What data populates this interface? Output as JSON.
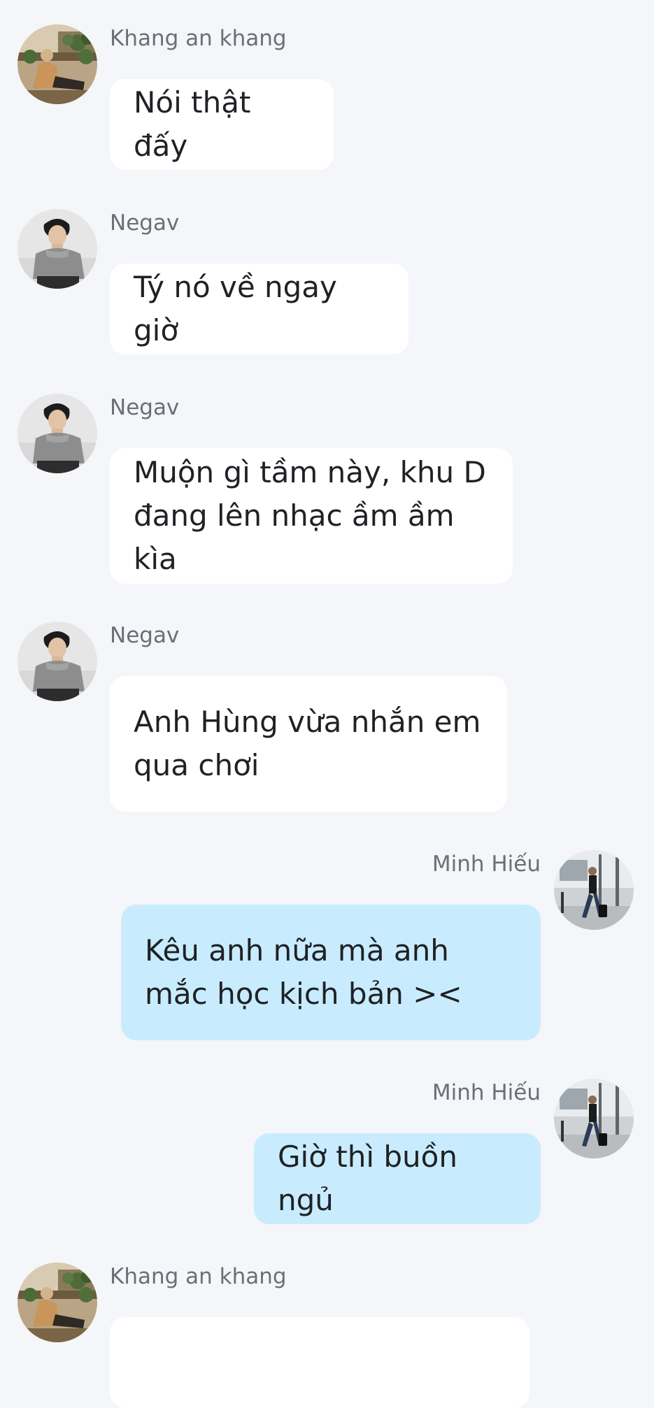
{
  "messages": [
    {
      "sender": "Khang an khang",
      "text": "Nói thật đấy",
      "direction": "incoming",
      "avatar": "avatar-khang-icon"
    },
    {
      "sender": "Negav",
      "text": "Tý nó về ngay giờ",
      "direction": "incoming",
      "avatar": "avatar-negav-icon"
    },
    {
      "sender": "Negav",
      "text": "Muộn gì tầm này, khu D đang lên nhạc ầm ầm kìa",
      "direction": "incoming",
      "avatar": "avatar-negav-icon"
    },
    {
      "sender": "Negav",
      "text": "Anh Hùng vừa nhắn em qua chơi",
      "direction": "incoming",
      "avatar": "avatar-negav-icon"
    },
    {
      "sender": "Minh Hiếu",
      "text": "Kêu anh nữa mà anh mắc học kịch bản ><",
      "direction": "outgoing",
      "avatar": "avatar-minhhieu-icon"
    },
    {
      "sender": "Minh Hiếu",
      "text": "Giờ thì buồn ngủ",
      "direction": "outgoing",
      "avatar": "avatar-minhhieu-icon"
    },
    {
      "sender": "Khang an khang",
      "text": "",
      "direction": "incoming",
      "avatar": "avatar-khang-icon"
    }
  ],
  "colors": {
    "background": "#f5f6f9",
    "incoming_bubble": "#ffffff",
    "outgoing_bubble": "#c8ecfd",
    "sender_name": "#6b6f76",
    "message_text": "#1f2125"
  }
}
